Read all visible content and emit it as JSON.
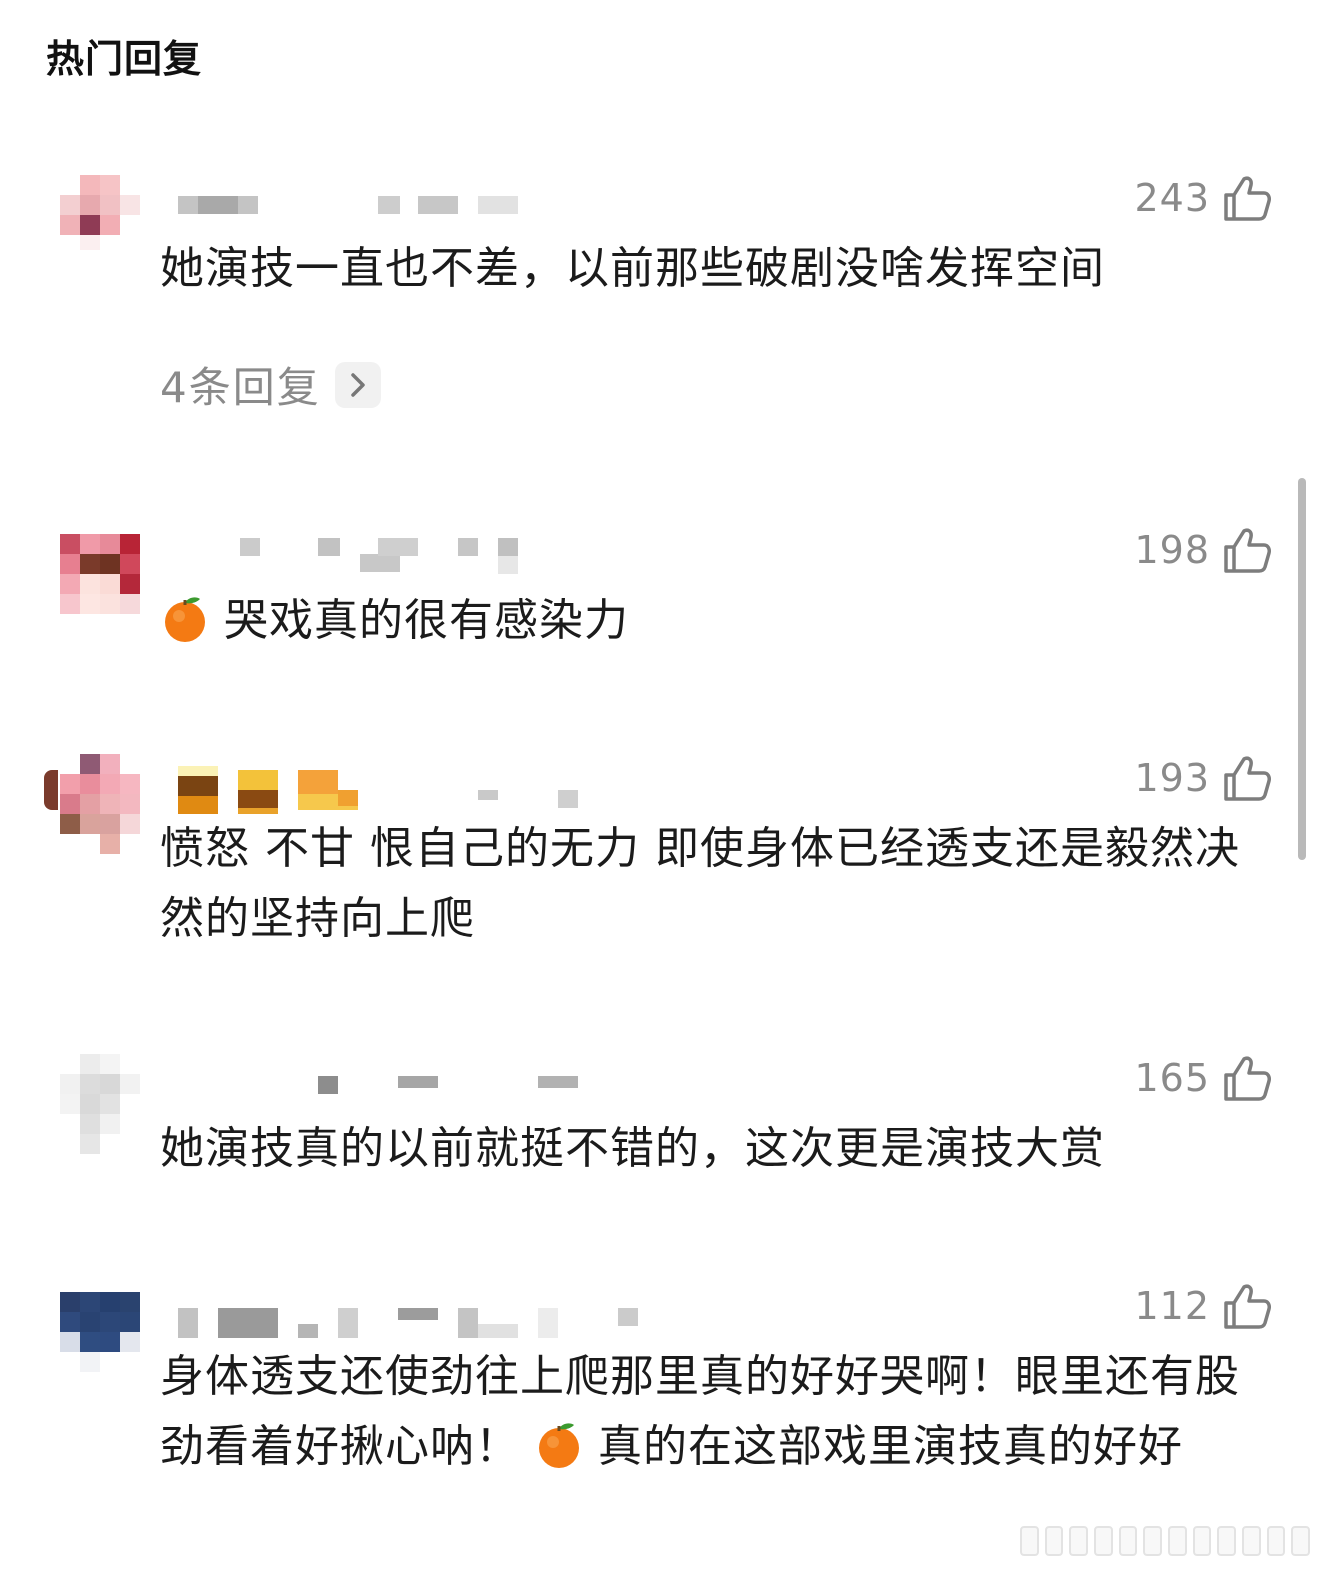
{
  "section": {
    "title": "热门回复"
  },
  "comments": [
    {
      "likes": "243",
      "text": "她演技一直也不差，以前那些破剧没啥发挥空间",
      "reply_label": "4条回复"
    },
    {
      "likes": "198",
      "emoji": "orange-emoji",
      "text": "哭戏真的很有感染力"
    },
    {
      "likes": "193",
      "text": "愤怒 不甘 恨自己的无力 即使身体已经透支还是毅然决然的坚持向上爬"
    },
    {
      "likes": "165",
      "text": "她演技真的以前就挺不错的，这次更是演技大赏"
    },
    {
      "likes": "112",
      "text_before_emoji": "身体透支还使劲往上爬那里真的好好哭啊！眼里还有股劲看着好揪心呐！",
      "emoji": "orange-emoji",
      "text_after_emoji": "真的在这部戏里演技真的好好"
    }
  ],
  "colors": {
    "like_gray": "#8a8a8a",
    "text": "#1b1b1b",
    "avatar_pink": "#e8a0a8",
    "avatar_navy": "#2d4a7c"
  }
}
